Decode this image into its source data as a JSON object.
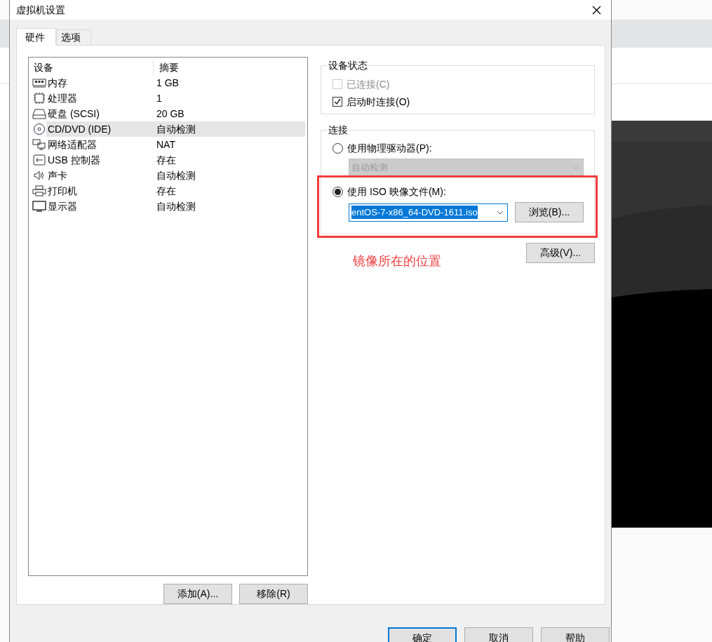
{
  "window": {
    "title": "虚拟机设置"
  },
  "tabs": [
    {
      "label": "硬件",
      "selected": true
    },
    {
      "label": "选项",
      "selected": false
    }
  ],
  "device_list": {
    "columns": [
      "设备",
      "摘要"
    ],
    "rows": [
      {
        "kind": "memory",
        "device": "内存",
        "summary": "1 GB",
        "selected": false
      },
      {
        "kind": "cpu",
        "device": "处理器",
        "summary": "1",
        "selected": false
      },
      {
        "kind": "disk",
        "device": "硬盘 (SCSI)",
        "summary": "20 GB",
        "selected": false
      },
      {
        "kind": "cd",
        "device": "CD/DVD (IDE)",
        "summary": "自动检测",
        "selected": true
      },
      {
        "kind": "network",
        "device": "网络适配器",
        "summary": "NAT",
        "selected": false
      },
      {
        "kind": "usb",
        "device": "USB 控制器",
        "summary": "存在",
        "selected": false
      },
      {
        "kind": "sound",
        "device": "声卡",
        "summary": "自动检测",
        "selected": false
      },
      {
        "kind": "printer",
        "device": "打印机",
        "summary": "存在",
        "selected": false
      },
      {
        "kind": "display",
        "device": "显示器",
        "summary": "自动检测",
        "selected": false
      }
    ]
  },
  "list_buttons": [
    "添加(A)...",
    "移除(R)"
  ],
  "device_status": {
    "title": "设备状态",
    "options": [
      {
        "label": "已连接(C)",
        "checked": false,
        "disabled": true
      },
      {
        "label": "启动时连接(O)",
        "checked": true,
        "disabled": false
      }
    ]
  },
  "connection": {
    "title": "连接",
    "options": [
      {
        "label": "使用物理驱动器(P):",
        "selected": false,
        "field": {
          "value": "自动检测",
          "disabled": true,
          "highlighted": false
        }
      },
      {
        "label": "使用 ISO 映像文件(M):",
        "selected": true,
        "field": {
          "value": "entOS-7-x86_64-DVD-1611.iso",
          "disabled": false,
          "highlighted": true
        },
        "button": "浏览(B)..."
      }
    ]
  },
  "advanced_button": "高级(V)...",
  "annotation": "镜像所在的位置",
  "dialog_buttons": [
    {
      "label": "确定",
      "default": true
    },
    {
      "label": "取消",
      "default": false
    },
    {
      "label": "帮助",
      "default": false
    }
  ]
}
